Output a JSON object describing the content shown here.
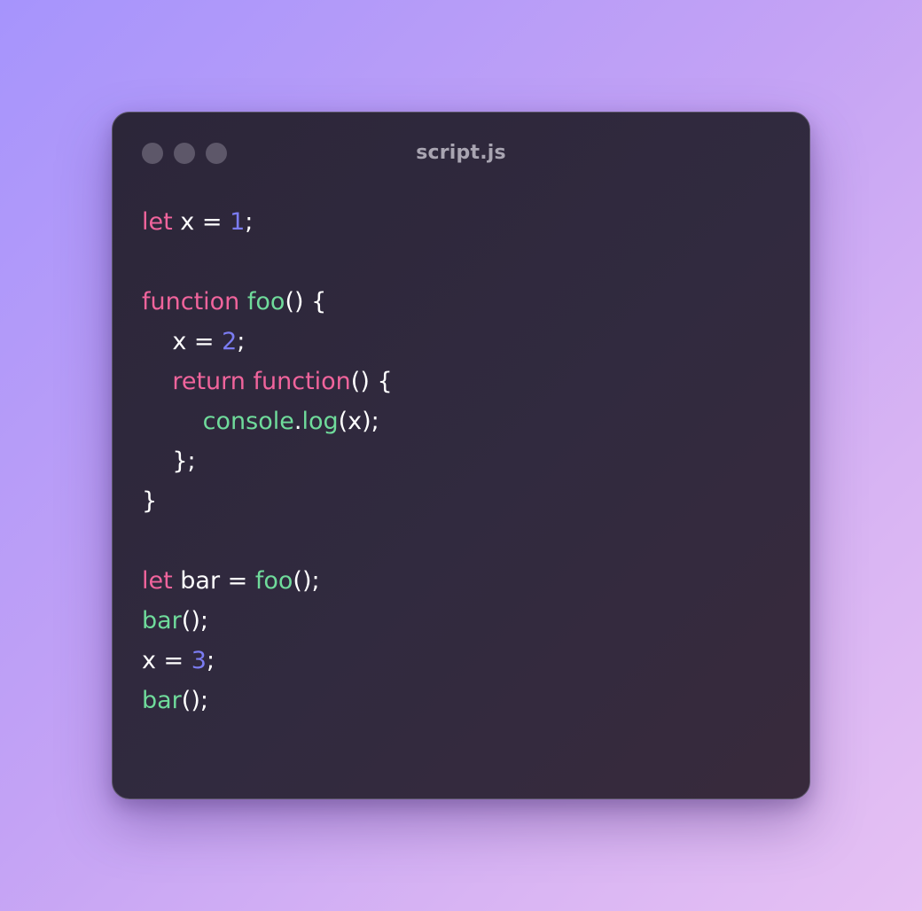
{
  "window": {
    "title": "script.js",
    "traffic_lights": [
      "close-dot",
      "minimize-dot",
      "zoom-dot"
    ]
  },
  "colors": {
    "keyword": "#f0649c",
    "function": "#6fdb9b",
    "number": "#7b7cf2",
    "plain": "#ffffff",
    "title": "#a9a5b2"
  },
  "code": {
    "language": "javascript",
    "lines": [
      [
        [
          "kw",
          "let"
        ],
        [
          "pl",
          " x = "
        ],
        [
          "num",
          "1"
        ],
        [
          "pl",
          ";"
        ]
      ],
      [],
      [
        [
          "kw",
          "function"
        ],
        [
          "pl",
          " "
        ],
        [
          "fn",
          "foo"
        ],
        [
          "pl",
          "() {"
        ]
      ],
      [
        [
          "pl",
          "    x = "
        ],
        [
          "num",
          "2"
        ],
        [
          "pl",
          ";"
        ]
      ],
      [
        [
          "pl",
          "    "
        ],
        [
          "kw",
          "return"
        ],
        [
          "pl",
          " "
        ],
        [
          "kw",
          "function"
        ],
        [
          "pl",
          "() {"
        ]
      ],
      [
        [
          "pl",
          "        "
        ],
        [
          "fn",
          "console"
        ],
        [
          "pl",
          "."
        ],
        [
          "fn",
          "log"
        ],
        [
          "pl",
          "(x);"
        ]
      ],
      [
        [
          "pl",
          "    };"
        ]
      ],
      [
        [
          "pl",
          "}"
        ]
      ],
      [],
      [
        [
          "kw",
          "let"
        ],
        [
          "pl",
          " bar = "
        ],
        [
          "fn",
          "foo"
        ],
        [
          "pl",
          "();"
        ]
      ],
      [
        [
          "fn",
          "bar"
        ],
        [
          "pl",
          "();"
        ]
      ],
      [
        [
          "pl",
          "x = "
        ],
        [
          "num",
          "3"
        ],
        [
          "pl",
          ";"
        ]
      ],
      [
        [
          "fn",
          "bar"
        ],
        [
          "pl",
          "();"
        ]
      ]
    ]
  }
}
